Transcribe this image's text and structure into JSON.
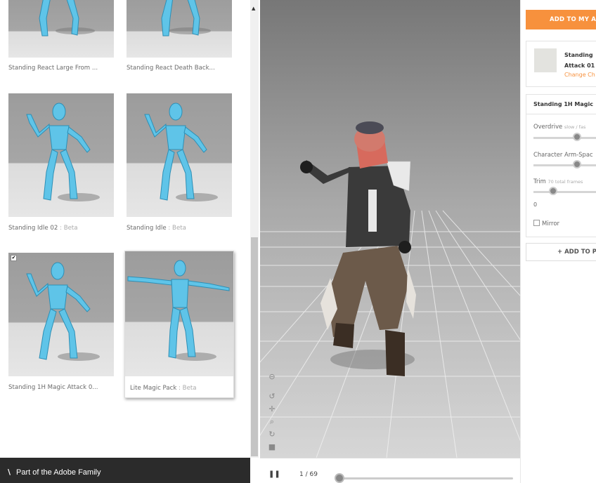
{
  "library": {
    "cards": [
      {
        "label": "Standing React Large From ...",
        "beta": ""
      },
      {
        "label": "Standing React Death Back...",
        "beta": ""
      },
      {
        "label": "Standing Idle 02",
        "beta": " : Beta"
      },
      {
        "label": "Standing Idle",
        "beta": " : Beta"
      },
      {
        "label": "Standing 1H Magic Attack 0...",
        "beta": "",
        "checked": "✔"
      },
      {
        "label": "Lite Magic Pack",
        "beta": " : Beta"
      }
    ],
    "scroll_up_glyph": "▲"
  },
  "footer": {
    "logo_glyph": "\\",
    "text": "Part of the Adobe Family"
  },
  "viewport": {
    "tools": [
      "⊖",
      "↺",
      "✛",
      "⌕",
      "↻",
      "■"
    ]
  },
  "timeline": {
    "pause_glyph": "❚❚",
    "frame": "1 / 69",
    "progress": 0.0
  },
  "sidebar": {
    "add_my_button": "ADD TO MY A",
    "selected": {
      "name_line1": "Standing",
      "name_line2": "Attack 01",
      "change": "Change Ch"
    },
    "settings": {
      "title": "Standing 1H Magic",
      "overdrive_label": "Overdrive",
      "overdrive_hint": "slow / fas",
      "arm_space_label": "Character Arm-Spac",
      "trim_label": "Trim",
      "trim_hint": "70 total frames",
      "trim_value": "0",
      "mirror_label": "Mirror"
    },
    "add_pack_button": "+ ADD TO P"
  },
  "colors": {
    "accent": "#f7913d",
    "figure": "#5fc4e8"
  }
}
